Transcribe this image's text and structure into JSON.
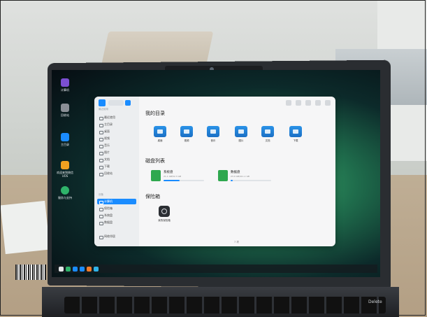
{
  "desktop_icons": [
    {
      "label": "计算机",
      "color": "#7b4fd1"
    },
    {
      "label": "回收站",
      "color": "#8a8f96"
    },
    {
      "label": "主目录",
      "color": "#1a8cff"
    },
    {
      "label": "欢迎来到统信UOS",
      "color": "#f0a020"
    },
    {
      "label": "服务与支持",
      "color": "#2fb36a"
    }
  ],
  "window": {
    "sidebar_groups": [
      "最近使用",
      "标签",
      "设备"
    ],
    "sidebar_items": [
      {
        "label": "最近使用"
      },
      {
        "label": "主目录"
      },
      {
        "label": "桌面"
      },
      {
        "label": "视频"
      },
      {
        "label": "音乐"
      },
      {
        "label": "图片"
      },
      {
        "label": "文档"
      },
      {
        "label": "下载"
      },
      {
        "label": "回收站"
      },
      {
        "label": "计算机",
        "active": true
      },
      {
        "label": "保险箱"
      },
      {
        "label": "系统盘"
      },
      {
        "label": "数据盘"
      },
      {
        "label": "网络邻居"
      }
    ],
    "my_dirs_title": "我的目录",
    "folders": [
      {
        "label": "桌面",
        "icon": "desktop-icon"
      },
      {
        "label": "视频",
        "icon": "video-icon"
      },
      {
        "label": "音乐",
        "icon": "music-icon"
      },
      {
        "label": "图片",
        "icon": "picture-icon"
      },
      {
        "label": "文档",
        "icon": "document-icon"
      },
      {
        "label": "下载",
        "icon": "download-icon"
      }
    ],
    "disks_title": "磁盘列表",
    "disks": [
      {
        "name": "系统盘",
        "size": "21.1 GB/52.3 GB",
        "used_fraction": 0.4
      },
      {
        "name": "数据盘",
        "size": "23.0 GB/411.1 GB",
        "used_fraction": 0.06
      }
    ],
    "vault_title": "保险箱",
    "vault_label": "我的保险箱",
    "status_text": "7 项"
  },
  "taskbar": {
    "apps": [
      {
        "name": "launcher",
        "color": "#e5e7ea"
      },
      {
        "name": "multitask",
        "color": "#2fb36a"
      },
      {
        "name": "file-manager",
        "color": "#1a8cff"
      },
      {
        "name": "browser",
        "color": "#1a8cff"
      },
      {
        "name": "store",
        "color": "#f07a2a"
      },
      {
        "name": "settings",
        "color": "#2fb3e8"
      }
    ],
    "tray_text": ""
  },
  "keyboard_labels": [
    "Delete"
  ]
}
